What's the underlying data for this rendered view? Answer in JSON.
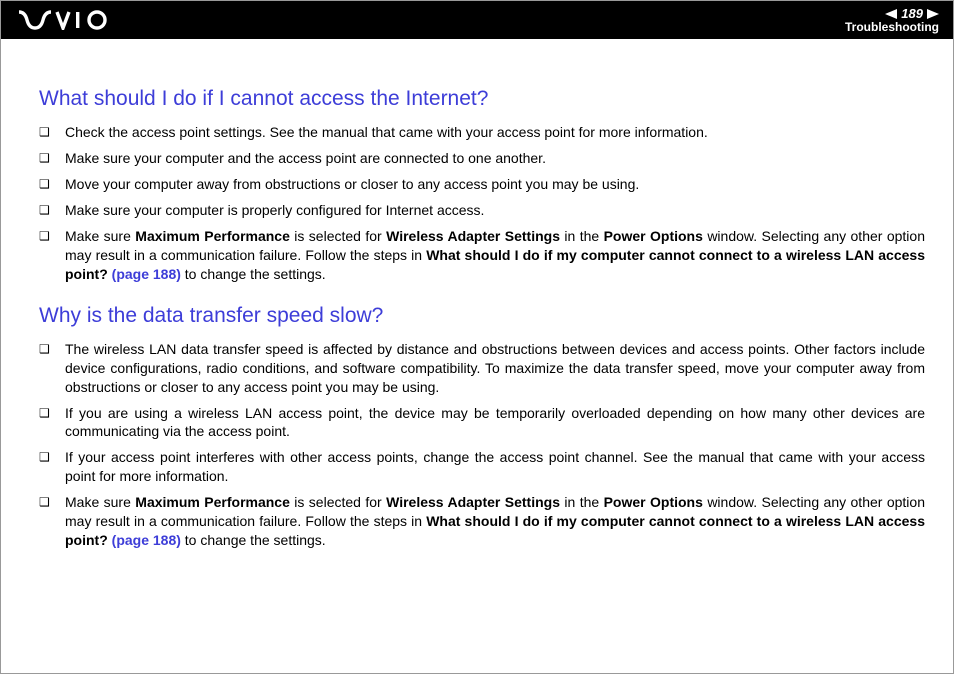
{
  "header": {
    "page_number": "189",
    "section": "Troubleshooting"
  },
  "q1": {
    "heading": "What should I do if I cannot access the Internet?",
    "items": {
      "i1": "Check the access point settings. See the manual that came with your access point for more information.",
      "i2": "Make sure your computer and the access point are connected to one another.",
      "i3": "Move your computer away from obstructions or closer to any access point you may be using.",
      "i4": "Make sure your computer is properly configured for Internet access.",
      "i5_pre": "Make sure ",
      "i5_b1": "Maximum Performance",
      "i5_mid1": " is selected for ",
      "i5_b2": "Wireless Adapter Settings",
      "i5_mid2": " in the ",
      "i5_b3": "Power Options",
      "i5_mid3": " window. Selecting any other option may result in a communication failure. Follow the steps in ",
      "i5_b4": "What should I do if my computer cannot connect to a wireless LAN access point?",
      "i5_link": " (page 188)",
      "i5_end": " to change the settings."
    }
  },
  "q2": {
    "heading": "Why is the data transfer speed slow?",
    "items": {
      "i1": "The wireless LAN data transfer speed is affected by distance and obstructions between devices and access points. Other factors include device configurations, radio conditions, and software compatibility. To maximize the data transfer speed, move your computer away from obstructions or closer to any access point you may be using.",
      "i2": "If you are using a wireless LAN access point, the device may be temporarily overloaded depending on how many other devices are communicating via the access point.",
      "i3": "If your access point interferes with other access points, change the access point channel. See the manual that came with your access point for more information.",
      "i4_pre": "Make sure ",
      "i4_b1": "Maximum Performance",
      "i4_mid1": " is selected for ",
      "i4_b2": "Wireless Adapter Settings",
      "i4_mid2": " in the ",
      "i4_b3": "Power Options",
      "i4_mid3": " window. Selecting any other option may result in a communication failure. Follow the steps in ",
      "i4_b4": "What should I do if my computer cannot connect to a wireless LAN access point?",
      "i4_link": " (page 188)",
      "i4_end": " to change the settings."
    }
  }
}
